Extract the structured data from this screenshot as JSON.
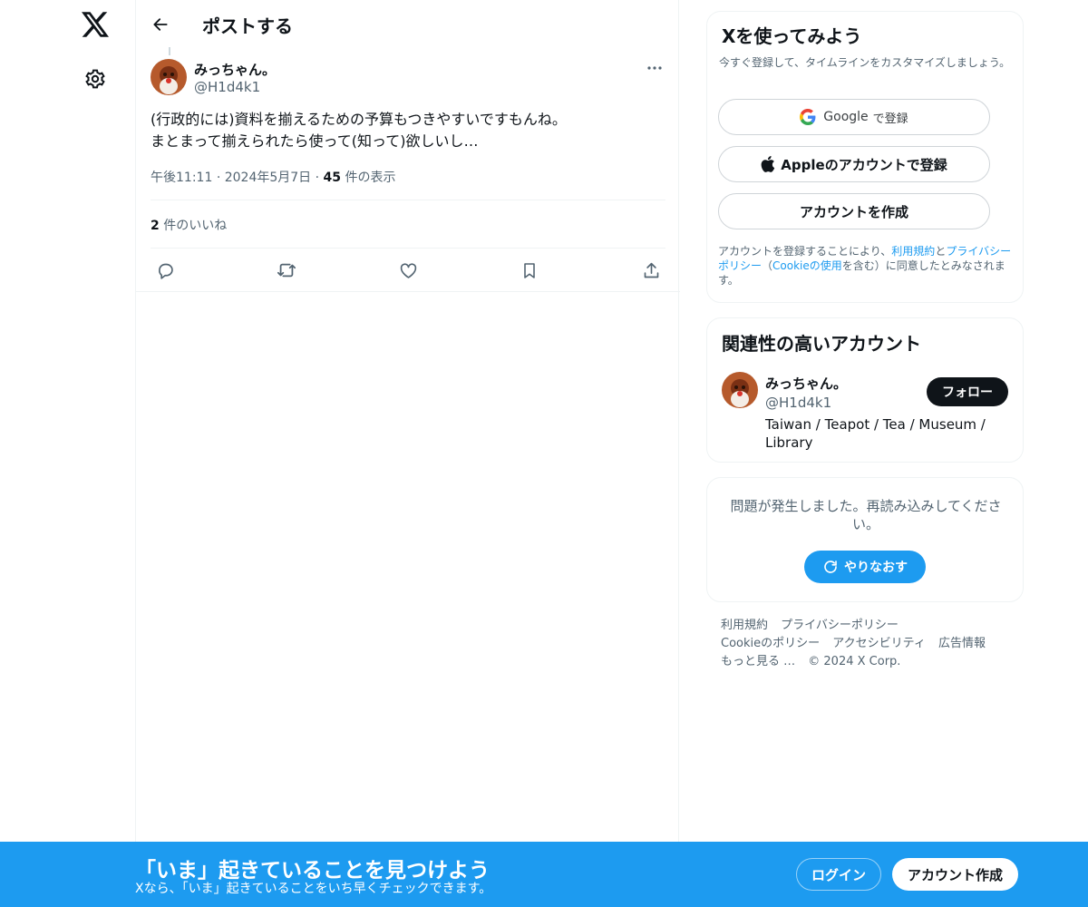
{
  "header": {
    "title": "ポストする"
  },
  "post": {
    "author_name": "みっちゃん。",
    "author_handle": "@H1d4k1",
    "text": "(行政的には)資料を揃えるための予算もつきやすいですもんね。\nまとまって揃えられたら使って(知って)欲しいし…",
    "time": "午後11:11",
    "date": "2024年5月7日",
    "views_count": "45",
    "views_label": "件の表示",
    "likes_count": "2",
    "likes_label": "件のいいね"
  },
  "signup_card": {
    "title": "Xを使ってみよう",
    "subtitle": "今すぐ登録して、タイムラインをカスタマイズしましょう。",
    "google_label_brand": "Google",
    "google_label_rest": "で登録",
    "apple_label": "Appleのアカウントで登録",
    "create_label": "アカウントを作成",
    "legal_1": "アカウントを登録することにより、",
    "legal_terms": "利用規約",
    "legal_2": "と",
    "legal_privacy": "プライバシーポリシー",
    "legal_3": "（",
    "legal_cookie": "Cookieの使用",
    "legal_4": "を含む）に同意したとみなされます。"
  },
  "related": {
    "title": "関連性の高いアカウント",
    "name": "みっちゃん。",
    "handle": "@H1d4k1",
    "bio": "Taiwan / Teapot / Tea / Museum / Library",
    "follow_label": "フォロー"
  },
  "error_card": {
    "message": "問題が発生しました。再読み込みしてください。",
    "retry_label": "やりなおす"
  },
  "footer": {
    "terms": "利用規約",
    "privacy": "プライバシーポリシー",
    "cookie": "Cookieのポリシー",
    "accessibility": "アクセシビリティ",
    "ads": "広告情報",
    "more": "もっと見る …",
    "copyright": "© 2024 X Corp."
  },
  "banner": {
    "title": "「いま」起きていることを見つけよう",
    "subtitle": "Xなら、「いま」起きていることをいち早くチェックできます。",
    "login_label": "ログイン",
    "signup_label": "アカウント作成"
  },
  "colors": {
    "accent": "#1d9bf0",
    "text": "#0f1419",
    "muted": "#536471",
    "border": "#eff3f4"
  },
  "icons": [
    "x-logo-icon",
    "gear-icon",
    "back-arrow-icon",
    "more-icon",
    "reply-icon",
    "repost-icon",
    "like-icon",
    "bookmark-icon",
    "share-icon",
    "google-icon",
    "apple-icon",
    "refresh-icon"
  ]
}
